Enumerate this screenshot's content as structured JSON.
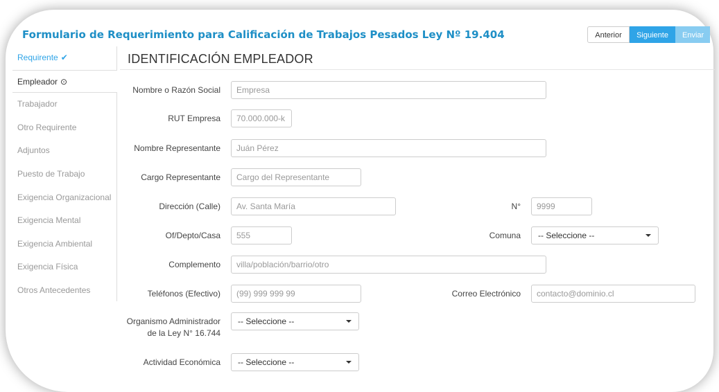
{
  "title": "Formulario de Requerimiento para Calificación de Trabajos Pesados Ley Nº 19.404",
  "buttons": {
    "anterior": "Anterior",
    "siguiente": "Siguiente",
    "enviar": "Enviar"
  },
  "sidebar": {
    "items": [
      {
        "label": "Requirente",
        "mark": "✔",
        "state": "done"
      },
      {
        "label": "Empleador",
        "mark": "⊙",
        "state": "active"
      },
      {
        "label": "Trabajador",
        "mark": "",
        "state": "pending"
      },
      {
        "label": "Otro Requirente",
        "mark": "",
        "state": "pending"
      },
      {
        "label": "Adjuntos",
        "mark": "",
        "state": "pending"
      },
      {
        "label": "Puesto de Trabajo",
        "mark": "",
        "state": "pending"
      },
      {
        "label": "Exigencia Organizacional",
        "mark": "",
        "state": "pending"
      },
      {
        "label": "Exigencia Mental",
        "mark": "",
        "state": "pending"
      },
      {
        "label": "Exigencia Ambiental",
        "mark": "",
        "state": "pending"
      },
      {
        "label": "Exigencia Física",
        "mark": "",
        "state": "pending"
      },
      {
        "label": "Otros Antecedentes",
        "mark": "",
        "state": "pending"
      }
    ]
  },
  "section": {
    "title": "IDENTIFICACIÓN EMPLEADOR"
  },
  "form": {
    "razon_social": {
      "label": "Nombre o Razón Social",
      "placeholder": "Empresa"
    },
    "rut": {
      "label": "RUT Empresa",
      "placeholder": "70.000.000-k"
    },
    "representante": {
      "label": "Nombre Representante",
      "placeholder": "Juán Pérez"
    },
    "cargo": {
      "label": "Cargo Representante",
      "placeholder": "Cargo del Representante"
    },
    "direccion": {
      "label": "Dirección (Calle)",
      "placeholder": "Av. Santa María"
    },
    "numero": {
      "label": "N°",
      "placeholder": "9999"
    },
    "depto": {
      "label": "Of/Depto/Casa",
      "placeholder": "555"
    },
    "comuna": {
      "label": "Comuna",
      "value": "-- Seleccione --"
    },
    "complemento": {
      "label": "Complemento",
      "placeholder": "villa/población/barrio/otro"
    },
    "telefonos": {
      "label": "Teléfonos (Efectivo)",
      "placeholder": "(99) 999 999 99"
    },
    "correo": {
      "label": "Correo Electrónico",
      "placeholder": "contacto@dominio.cl"
    },
    "organismo": {
      "label_line1": "Organismo Administrador",
      "label_line2": "de la Ley N° 16.744",
      "value": "-- Seleccione --"
    },
    "actividad": {
      "label": "Actividad Económica",
      "value": "-- Seleccione --"
    }
  },
  "colors": {
    "accent": "#2fa4e7",
    "title": "#1e8fc6",
    "disabled": "#88ccf1"
  }
}
